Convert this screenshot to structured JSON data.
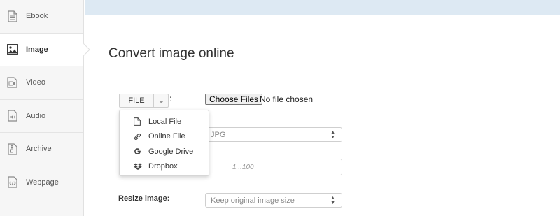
{
  "sidebar": {
    "items": [
      {
        "label": "Ebook",
        "icon": "ebook-icon",
        "active": false
      },
      {
        "label": "Image",
        "icon": "image-icon",
        "active": true
      },
      {
        "label": "Video",
        "icon": "video-icon",
        "active": false
      },
      {
        "label": "Audio",
        "icon": "audio-icon",
        "active": false
      },
      {
        "label": "Archive",
        "icon": "archive-icon",
        "active": false
      },
      {
        "label": "Webpage",
        "icon": "webpage-icon",
        "active": false
      }
    ]
  },
  "main": {
    "title": "Convert image online",
    "file_button_label": "FILE",
    "colon": ":",
    "choose_files_label": "Choose Files",
    "no_file_text": "No file chosen",
    "target_select_value": "JPG",
    "quality_placeholder": "1...100",
    "resize_label": "Resize image:",
    "resize_select_value": "Keep original image size"
  },
  "dropdown": {
    "items": [
      {
        "label": "Local File",
        "icon": "file-icon"
      },
      {
        "label": "Online File",
        "icon": "link-icon"
      },
      {
        "label": "Google Drive",
        "icon": "google-drive-icon"
      },
      {
        "label": "Dropbox",
        "icon": "dropbox-icon"
      }
    ]
  },
  "colors": {
    "banner": "#dde9f3",
    "sidebar_bg": "#f6f6f6",
    "text": "#333333"
  }
}
